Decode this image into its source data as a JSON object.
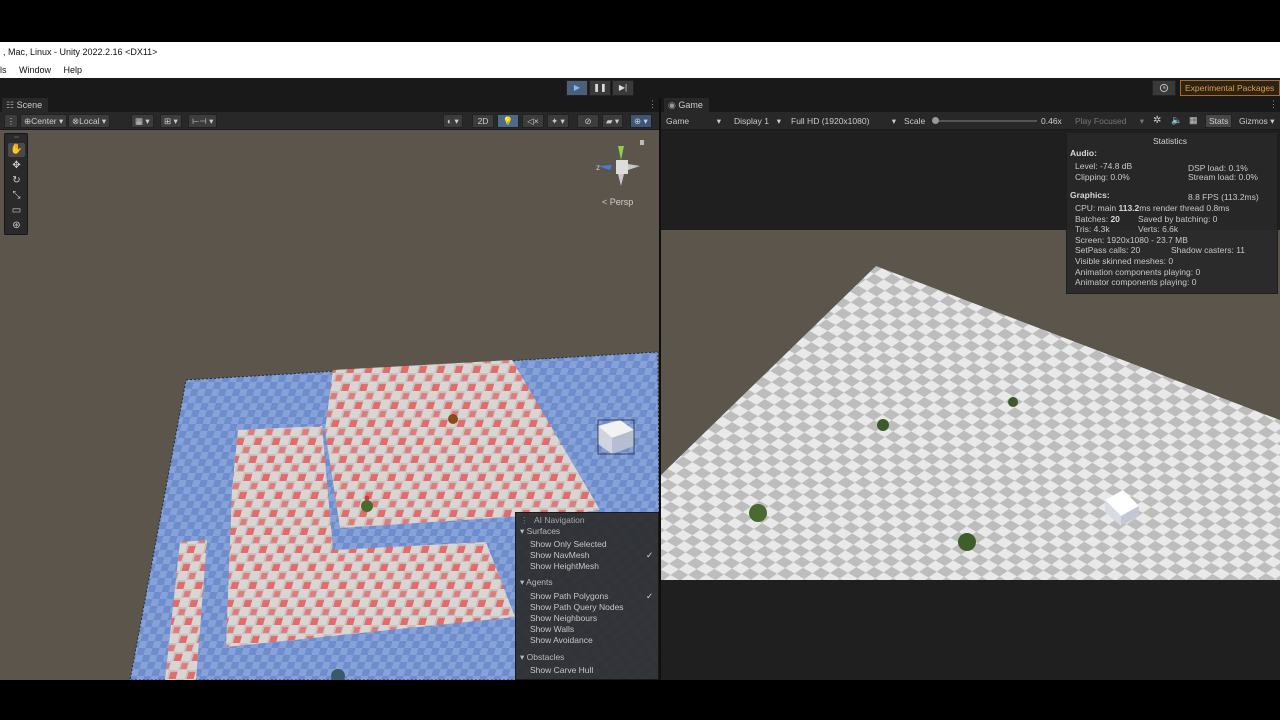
{
  "window": {
    "title": ", Mac, Linux - Unity 2022.2.16 <DX11>"
  },
  "menu": {
    "items": [
      "ls",
      "Window",
      "Help"
    ]
  },
  "toolbar": {
    "play": "▶",
    "pause": "❚❚",
    "step": "▶|",
    "history_icon": "history-icon",
    "experimental_packages": "Experimental Packages"
  },
  "scene": {
    "tab_label": "Scene",
    "pivot": "Center",
    "space": "Local",
    "mode_2d": "2D",
    "persp_label": "< Persp",
    "gizmo_axis_z": "z"
  },
  "game": {
    "tab_label": "Game",
    "view_select": "Game",
    "display": "Display 1",
    "resolution": "Full HD (1920x1080)",
    "scale_label": "Scale",
    "scale_value": "0.46x",
    "scale_fraction": 0.46,
    "play_focused": "Play Focused",
    "stats_btn": "Stats",
    "gizmos_btn": "Gizmos"
  },
  "statistics": {
    "title": "Statistics",
    "audio_header": "Audio:",
    "level": "Level: -74.8 dB",
    "clipping": "Clipping: 0.0%",
    "dsp_load": "DSP load: 0.1%",
    "stream_load": "Stream load: 0.0%",
    "graphics_header": "Graphics:",
    "fps": "8.8 FPS (113.2ms)",
    "cpu_prefix": "CPU: main ",
    "cpu_main": "113.2",
    "cpu_suffix": "ms  render thread 0.8ms",
    "batches_prefix": "Batches: ",
    "batches_value": "20",
    "saved_batching": "Saved by batching: 0",
    "tris": "Tris: 4.3k",
    "verts": "Verts: 6.6k",
    "screen": "Screen: 1920x1080 - 23.7 MB",
    "setpass": "SetPass calls: 20",
    "shadow_casters": "Shadow casters: 11",
    "skinned": "Visible skinned meshes: 0",
    "animation": "Animation components playing: 0",
    "animator": "Animator components playing: 0"
  },
  "ai_navigation": {
    "title": "AI Navigation",
    "surfaces_header": "Surfaces",
    "show_only_selected": "Show Only Selected",
    "show_navmesh": "Show NavMesh",
    "show_heightmesh": "Show HeightMesh",
    "agents_header": "Agents",
    "show_path_polygons": "Show Path Polygons",
    "show_path_query_nodes": "Show Path Query Nodes",
    "show_neighbours": "Show Neighbours",
    "show_walls": "Show Walls",
    "show_avoidance": "Show Avoidance",
    "obstacles_header": "Obstacles",
    "show_carve_hull": "Show Carve Hull",
    "checkmark": "✓"
  },
  "colors": {
    "navmesh_blue": "#6f8fcf",
    "tile_red": "#e26a6a",
    "sky_scene": "#5b554b",
    "accent_orange": "#e89a3a"
  }
}
